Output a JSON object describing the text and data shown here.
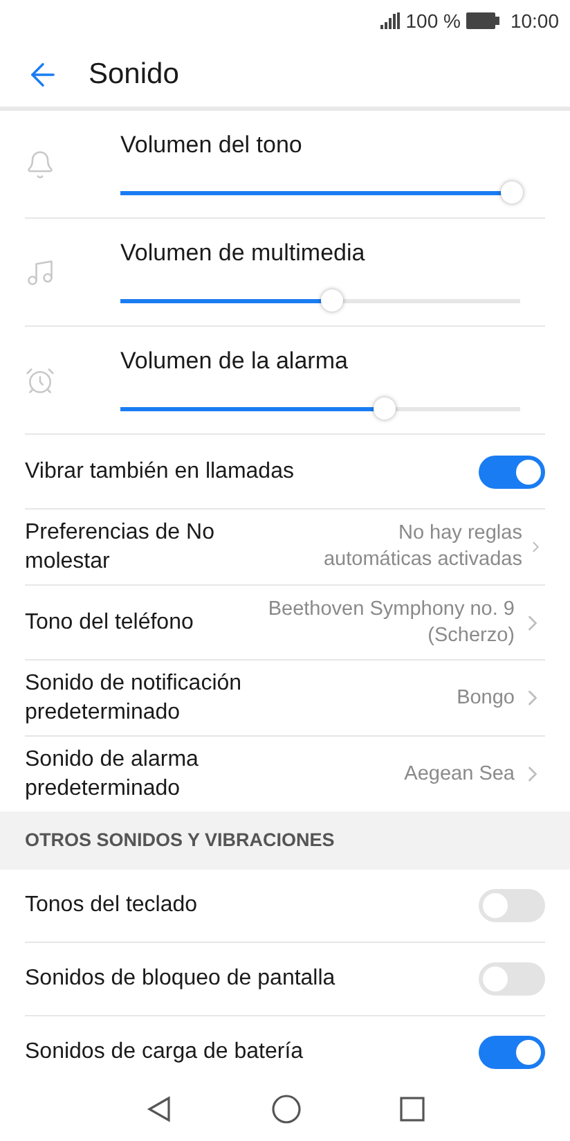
{
  "status_bar": {
    "battery_text": "100 %",
    "time": "10:00"
  },
  "header": {
    "title": "Sonido"
  },
  "volume_sliders": [
    {
      "kind": "bell",
      "label": "Volumen del tono",
      "level": 0.98
    },
    {
      "kind": "music",
      "label": "Volumen de multimedia",
      "level": 0.53
    },
    {
      "kind": "alarm",
      "label": "Volumen de la alarma",
      "level": 0.66
    }
  ],
  "settings": [
    {
      "kind": "toggle",
      "label": "Vibrar también en llamadas",
      "on": true
    },
    {
      "kind": "link",
      "label": "Preferencias de No molestar",
      "value": "No hay reglas automáticas activadas"
    },
    {
      "kind": "link",
      "label": "Tono del teléfono",
      "value": "Beethoven Symphony no. 9 (Scherzo)"
    },
    {
      "kind": "link",
      "label": "Sonido de notificación predeterminado",
      "value": "Bongo"
    },
    {
      "kind": "link",
      "label": "Sonido de alarma predeterminado",
      "value": "Aegean Sea"
    }
  ],
  "other_section": {
    "title": "OTROS SONIDOS Y VIBRACIONES",
    "items": [
      {
        "label": "Tonos del teclado",
        "on": false
      },
      {
        "label": "Sonidos de bloqueo de pantalla",
        "on": false
      },
      {
        "label": "Sonidos de carga de batería",
        "on": true
      }
    ]
  }
}
